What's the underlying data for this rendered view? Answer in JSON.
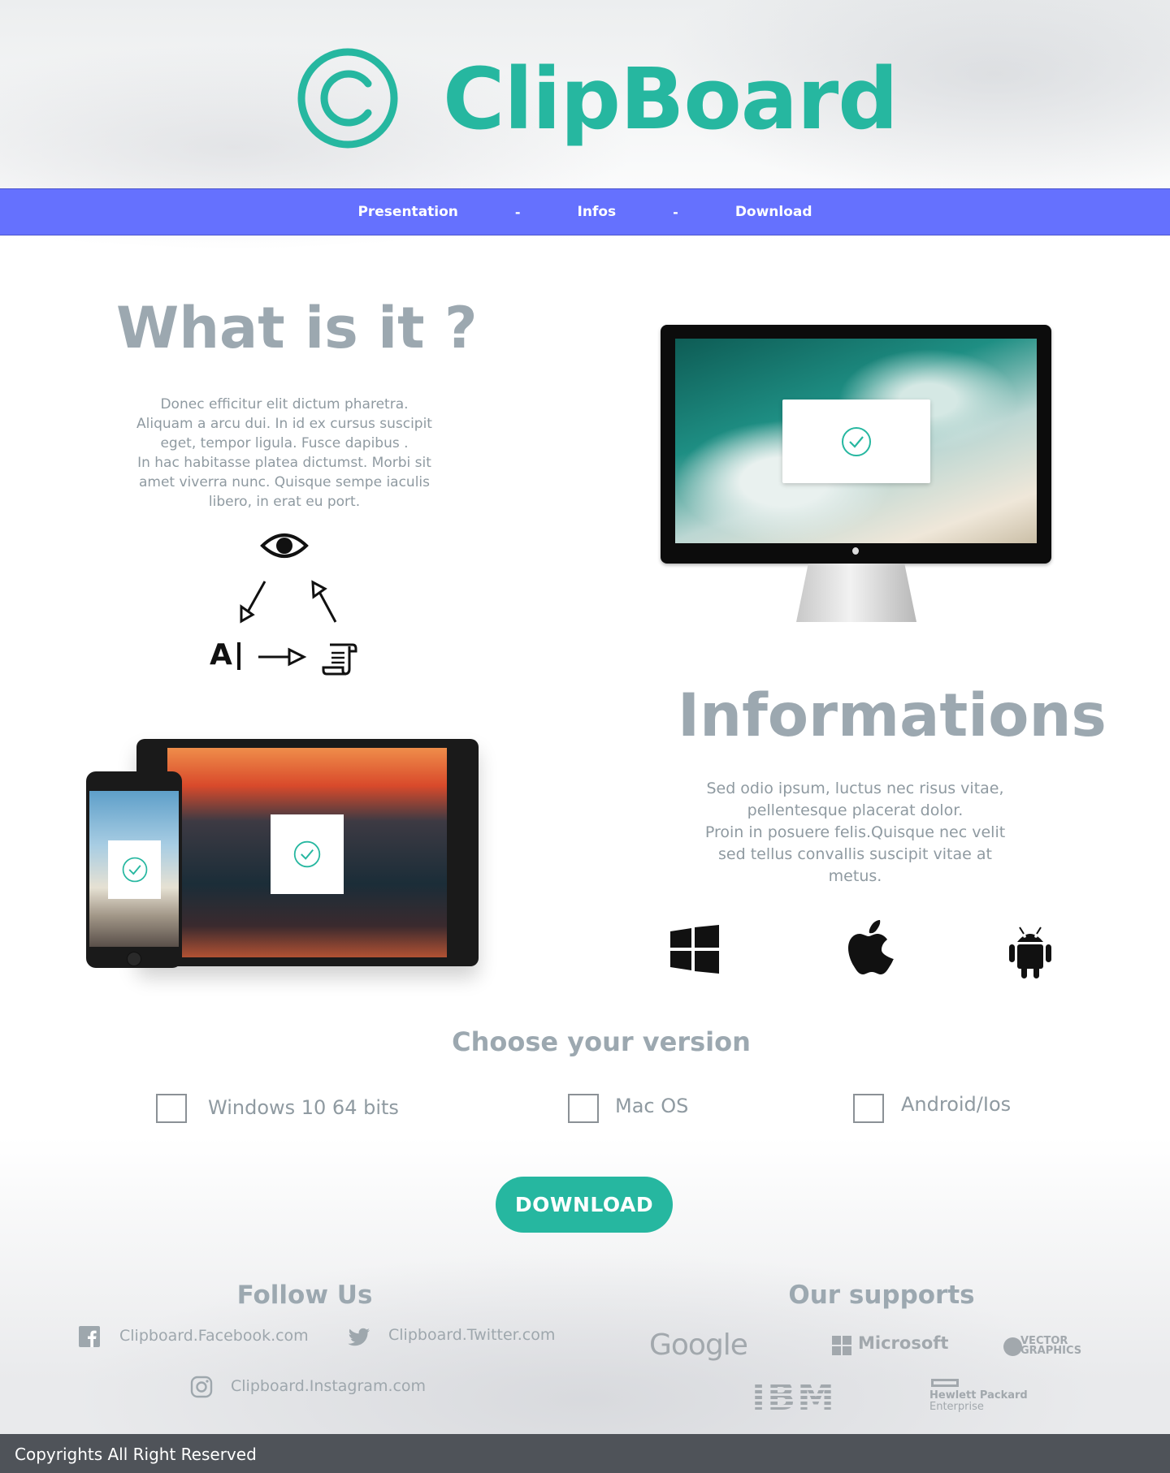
{
  "header": {
    "brand_name": "ClipBoard",
    "logo_icon": "copyright-icon"
  },
  "nav": {
    "items": [
      "Presentation",
      "Infos",
      "Download"
    ],
    "separator": "-"
  },
  "what": {
    "title": "What is it ?",
    "lines": [
      "Donec efficitur elit dictum pharetra.",
      "Aliquam a arcu dui. In id ex cursus suscipit",
      "eget, tempor ligula. Fusce dapibus .",
      "In hac habitasse platea dictumst. Morbi sit",
      "amet viverra nunc. Quisque sempe iaculis",
      "libero, in erat eu port."
    ],
    "diagram_icons": [
      "eye-icon",
      "ai-text-icon",
      "scroll-document-icon",
      "arrow-icon"
    ],
    "diagram_text": "A"
  },
  "info": {
    "title": "Informations",
    "lines": [
      "Sed odio ipsum, luctus nec risus vitae,",
      "pellentesque placerat dolor.",
      "Proin in posuere felis.Quisque nec velit",
      "sed tellus convallis suscipit vitae at",
      "metus."
    ],
    "platform_icons": [
      "windows-icon",
      "apple-icon",
      "android-icon"
    ]
  },
  "versions": {
    "title": "Choose your version",
    "options": [
      {
        "label": "Windows 10 64 bits",
        "checked": false
      },
      {
        "label": "Mac OS",
        "checked": false
      },
      {
        "label": "Android/Ios",
        "checked": false
      }
    ],
    "button_label": "DOWNLOAD"
  },
  "follow": {
    "title": "Follow Us",
    "links": [
      {
        "icon": "facebook-icon",
        "text": "Clipboard.Facebook.com"
      },
      {
        "icon": "twitter-icon",
        "text": "Clipboard.Twitter.com"
      },
      {
        "icon": "instagram-icon",
        "text": "Clipboard.Instagram.com"
      }
    ]
  },
  "supports": {
    "title": "Our supports",
    "brands": {
      "google": "Google",
      "microsoft": "Microsoft",
      "vector_line1": "VECTOR",
      "vector_line2": "GRAPHICS",
      "ibm": "IBM",
      "hp_line1": "Hewlett Packard",
      "hp_line2": "Enterprise"
    }
  },
  "footer": {
    "text": "Copyrights All Right Reserved"
  },
  "colors": {
    "accent": "#26b7a0",
    "nav": "#6571fe",
    "heading": "#9ca8b0",
    "footer": "#4f5359"
  }
}
